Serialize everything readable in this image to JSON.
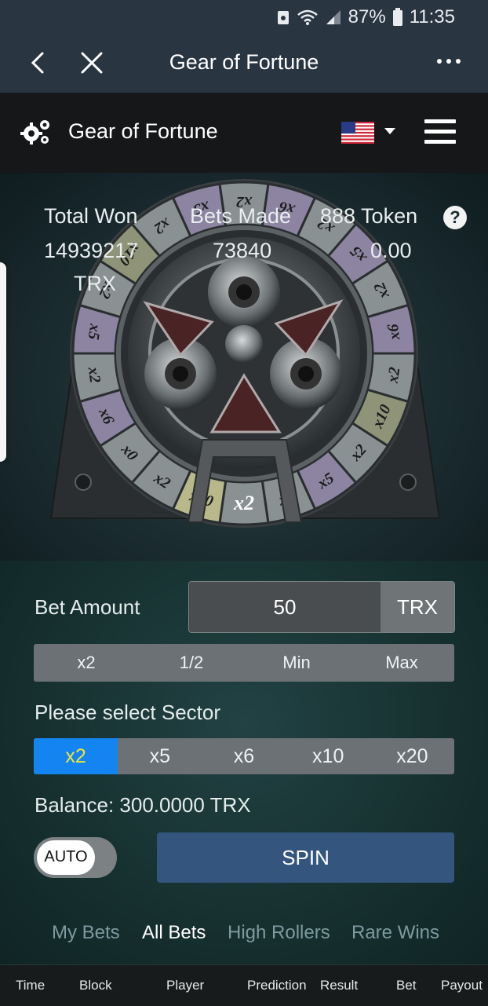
{
  "status_bar": {
    "battery": "87%",
    "time": "11:35"
  },
  "app_bar": {
    "title": "Gear of Fortune"
  },
  "header": {
    "title": "Gear of Fortune"
  },
  "stats": {
    "total_won_label": "Total Won",
    "total_won_value": "14939217",
    "total_won_unit": "TRX",
    "bets_made_label": "Bets Made",
    "bets_made_value": "73840",
    "token_label": "888 Token",
    "token_value": "0.00",
    "help_glyph": "?"
  },
  "wheel": {
    "segments": [
      "x2",
      "x20",
      "x2",
      "x0",
      "x6",
      "x2",
      "x5",
      "x2",
      "x10",
      "x2",
      "x5",
      "x2",
      "x6",
      "x2",
      "x5",
      "x2",
      "x6",
      "x2",
      "x10",
      "x2",
      "x5",
      "x2"
    ]
  },
  "bet": {
    "label": "Bet Amount",
    "value": "50",
    "unit": "TRX",
    "quick": [
      "x2",
      "1/2",
      "Min",
      "Max"
    ]
  },
  "sector": {
    "label": "Please select Sector",
    "options": [
      "x2",
      "x5",
      "x6",
      "x10",
      "x20"
    ],
    "selected": "x2"
  },
  "balance": "Balance: 300.0000 TRX",
  "auto_label": "AUTO",
  "spin_label": "SPIN",
  "tabs": [
    "My Bets",
    "All Bets",
    "High Rollers",
    "Rare Wins"
  ],
  "active_tab": "All Bets",
  "table_headers": [
    "Time",
    "Block",
    "Player",
    "Prediction",
    "Result",
    "Bet",
    "Payout"
  ],
  "colors": {
    "accent": "#1485f0",
    "spin": "#33557e",
    "selected_text": "#f2e33a"
  }
}
